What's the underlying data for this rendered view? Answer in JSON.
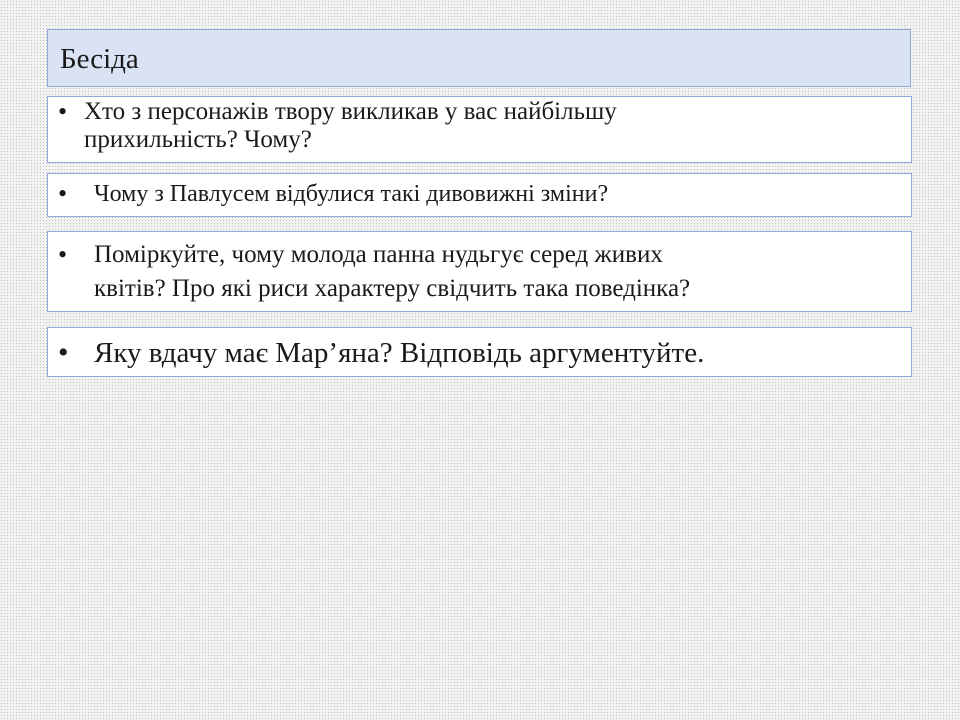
{
  "slide": {
    "title": "Бесіда",
    "bullet_symbol": "•",
    "questions": [
      {
        "text": "Хто з персонажів твору викликав у вас найбільшу\nприхильність? Чому?"
      },
      {
        "text": "Чому з Павлусем відбулися такі дивовижні зміни?"
      },
      {
        "text": "Поміркуйте, чому молода панна нудьгує серед живих\nквітів? Про які риси характеру свідчить така поведінка?"
      },
      {
        "text": "Яку вдачу має Мар’яна? Відповідь аргументуйте."
      }
    ]
  },
  "colors": {
    "title_bg": "#dae3f3",
    "box_border": "#8eaadb",
    "box_bg": "#ffffff",
    "page_bg": "#f2f2f2"
  }
}
